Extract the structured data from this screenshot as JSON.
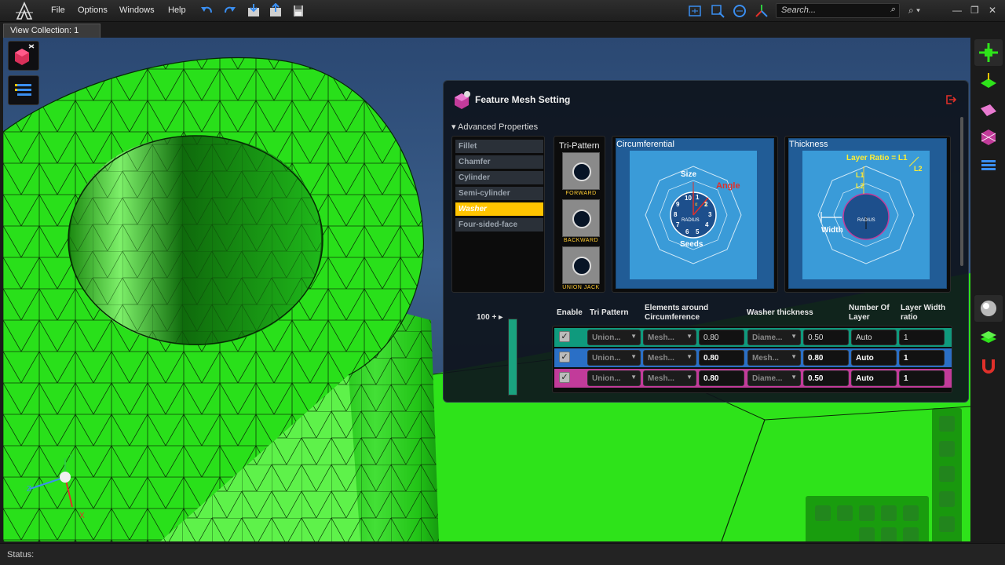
{
  "menu": {
    "file": "File",
    "options": "Options",
    "windows": "Windows",
    "help": "Help"
  },
  "search": {
    "placeholder": "Search..."
  },
  "tab": {
    "label": "View Collection: 1"
  },
  "panel": {
    "title": "Feature Mesh Setting",
    "advanced_properties": "Advanced Properties",
    "features": [
      "Fillet",
      "Chamfer",
      "Cylinder",
      "Semi-cylinder",
      "Washer",
      "Four-sided-face"
    ],
    "active_feature": "Washer",
    "tri_pattern": {
      "label": "Tri-Pattern",
      "items": [
        "FORWARD",
        "BACKWARD",
        "UNION JACK"
      ]
    },
    "circumferential": {
      "label": "Circumferential",
      "size": "Size",
      "angle": "Angle",
      "radius": "RADIUS",
      "seeds": "Seeds",
      "numbers": [
        "10",
        "1",
        "2",
        "3",
        "4",
        "5",
        "6",
        "7",
        "8",
        "9"
      ],
      "sub_a": "α",
      "sub_l": "L"
    },
    "thickness": {
      "label": "Thickness",
      "layer_ratio": "Layer Ratio = L1",
      "l2": "L2",
      "l1_label": "L1",
      "l2_label": "L2",
      "width": "Width",
      "radius": "RADIUS"
    },
    "slider": {
      "label": "100 +",
      "level_percent": 100
    },
    "table": {
      "headers": {
        "enable": "Enable",
        "tri_pattern": "Tri Pattern",
        "elements_1": "Elements around",
        "elements_2": "Circumference",
        "washer": "Washer thickness",
        "layers_1": "Number Of",
        "layers_2": "Layer",
        "ratio_1": "Layer Width",
        "ratio_2": "ratio"
      },
      "rows": [
        {
          "enabled": true,
          "tri_pattern": "Union...",
          "elements_mode": "Mesh...",
          "elements_value": "0.80",
          "washer_mode": "Diame...",
          "washer_value": "0.50",
          "layers": "Auto",
          "ratio": "1",
          "color": "#0f9a7d"
        },
        {
          "enabled": true,
          "tri_pattern": "Union...",
          "elements_mode": "Mesh...",
          "elements_value": "0.80",
          "washer_mode": "Mesh...",
          "washer_value": "0.80",
          "layers": "Auto",
          "ratio": "1",
          "color": "#2a6fc6"
        },
        {
          "enabled": true,
          "tri_pattern": "Union...",
          "elements_mode": "Mesh...",
          "elements_value": "0.80",
          "washer_mode": "Diame...",
          "washer_value": "0.50",
          "layers": "Auto",
          "ratio": "1",
          "color": "#c23b9a"
        }
      ]
    }
  },
  "axes": {
    "x": "X",
    "y": "Y",
    "z": "Z"
  },
  "status": {
    "label": "Status:"
  },
  "colors": {
    "mesh_green": "#29e01a",
    "accent_yellow": "#ffc400",
    "panel_bg": "#0e141c"
  }
}
